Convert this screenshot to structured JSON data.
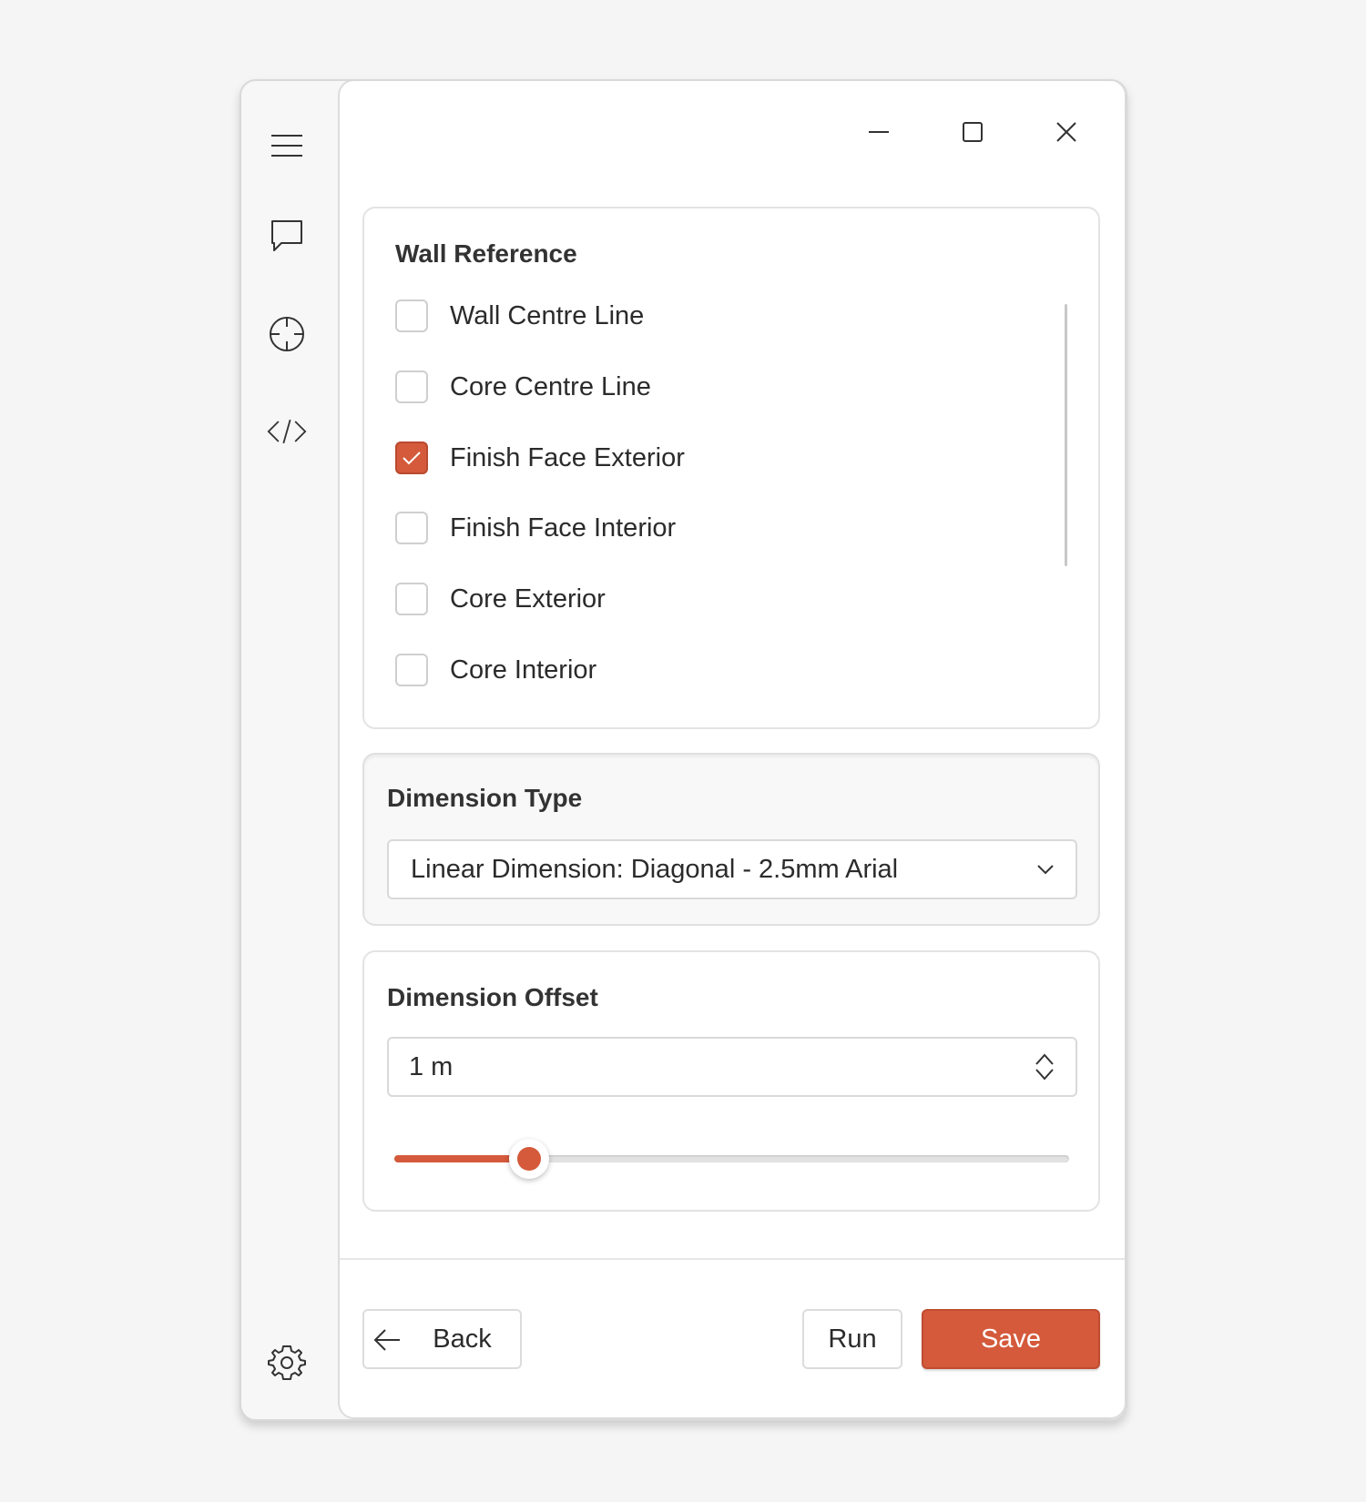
{
  "colors": {
    "accent": "#d45a3b",
    "window_bg": "#f7f7f7",
    "content_bg": "#ffffff",
    "text": "#2b2b2b"
  },
  "sidebar": {
    "items": [
      {
        "name": "menu",
        "icon": "hamburger-menu-icon"
      },
      {
        "name": "chat",
        "icon": "chat-bubble-icon"
      },
      {
        "name": "target",
        "icon": "crosshair-icon"
      },
      {
        "name": "code",
        "icon": "code-icon"
      }
    ],
    "footer_icon": "gear-icon"
  },
  "window_controls": {
    "minimize": "minimize-icon",
    "maximize": "maximize-icon",
    "close": "close-icon"
  },
  "wall_reference": {
    "title": "Wall Reference",
    "options": [
      {
        "label": "Wall Centre Line",
        "checked": false
      },
      {
        "label": "Core Centre Line",
        "checked": false
      },
      {
        "label": "Finish Face Exterior",
        "checked": true
      },
      {
        "label": "Finish Face Interior",
        "checked": false
      },
      {
        "label": "Core Exterior",
        "checked": false
      },
      {
        "label": "Core Interior",
        "checked": false
      }
    ]
  },
  "dimension_type": {
    "title": "Dimension Type",
    "selected": "Linear Dimension: Diagonal - 2.5mm Arial"
  },
  "dimension_offset": {
    "title": "Dimension Offset",
    "value": "1 m",
    "slider_fraction": 0.2
  },
  "footer": {
    "back_label": "Back",
    "run_label": "Run",
    "save_label": "Save"
  }
}
